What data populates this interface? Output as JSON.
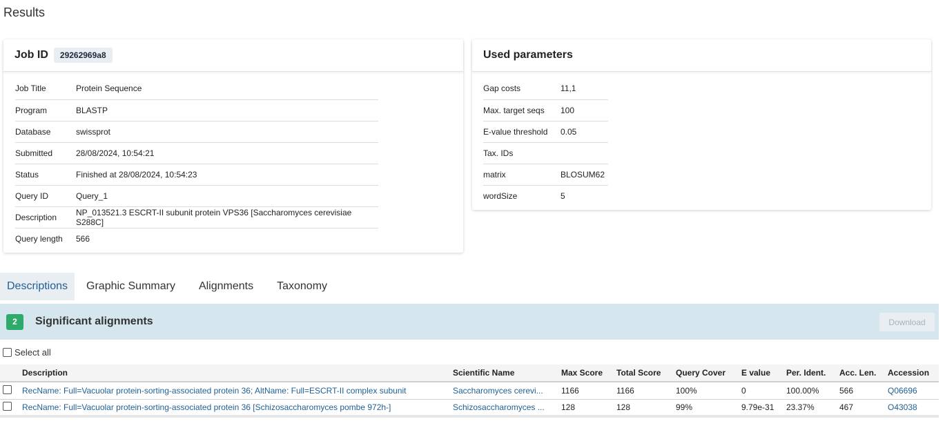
{
  "page": {
    "title": "Results"
  },
  "job_card": {
    "label": "Job ID",
    "job_id": "29262969a8",
    "fields": [
      {
        "key": "Job Title",
        "value": "Protein Sequence"
      },
      {
        "key": "Program",
        "value": "BLASTP"
      },
      {
        "key": "Database",
        "value": "swissprot"
      },
      {
        "key": "Submitted",
        "value": "28/08/2024, 10:54:21"
      },
      {
        "key": "Status",
        "value": "Finished at 28/08/2024, 10:54:23"
      },
      {
        "key": "Query ID",
        "value": "Query_1"
      },
      {
        "key": "Description",
        "value": "NP_013521.3 ESCRT-II subunit protein VPS36 [Saccharomyces cerevisiae S288C]"
      },
      {
        "key": "Query length",
        "value": "566"
      }
    ]
  },
  "params_card": {
    "title": "Used parameters",
    "fields": [
      {
        "key": "Gap costs",
        "value": "11,1"
      },
      {
        "key": "Max. target seqs",
        "value": "100"
      },
      {
        "key": "E-value threshold",
        "value": "0.05"
      },
      {
        "key": "Tax. IDs",
        "value": ""
      },
      {
        "key": "matrix",
        "value": "BLOSUM62"
      },
      {
        "key": "wordSize",
        "value": "5"
      }
    ]
  },
  "tabs": [
    {
      "label": "Descriptions",
      "active": true
    },
    {
      "label": "Graphic Summary",
      "active": false
    },
    {
      "label": "Alignments",
      "active": false
    },
    {
      "label": "Taxonomy",
      "active": false
    }
  ],
  "alignments": {
    "count": "2",
    "title": "Significant alignments",
    "download_label": "Download",
    "select_all_label": "Select all",
    "count_color": "#2eab6a",
    "link_color": "#1f5f94",
    "columns": [
      "Description",
      "Scientific Name",
      "Max Score",
      "Total Score",
      "Query Cover",
      "E value",
      "Per. Ident.",
      "Acc. Len.",
      "Accession"
    ],
    "rows": [
      {
        "description": "RecName: Full=Vacuolar protein-sorting-associated protein 36; AltName: Full=ESCRT-II complex subunit",
        "scientific_name": "Saccharomyces cerevi...",
        "max_score": "1166",
        "total_score": "1166",
        "query_cover": "100%",
        "e_value": "0",
        "per_ident": "100.00%",
        "acc_len": "566",
        "accession": "Q06696"
      },
      {
        "description": "RecName: Full=Vacuolar protein-sorting-associated protein 36 [Schizosaccharomyces pombe 972h-]",
        "scientific_name": "Schizosaccharomyces ...",
        "max_score": "128",
        "total_score": "128",
        "query_cover": "99%",
        "e_value": "9.79e-31",
        "per_ident": "23.37%",
        "acc_len": "467",
        "accession": "O43038"
      }
    ]
  }
}
